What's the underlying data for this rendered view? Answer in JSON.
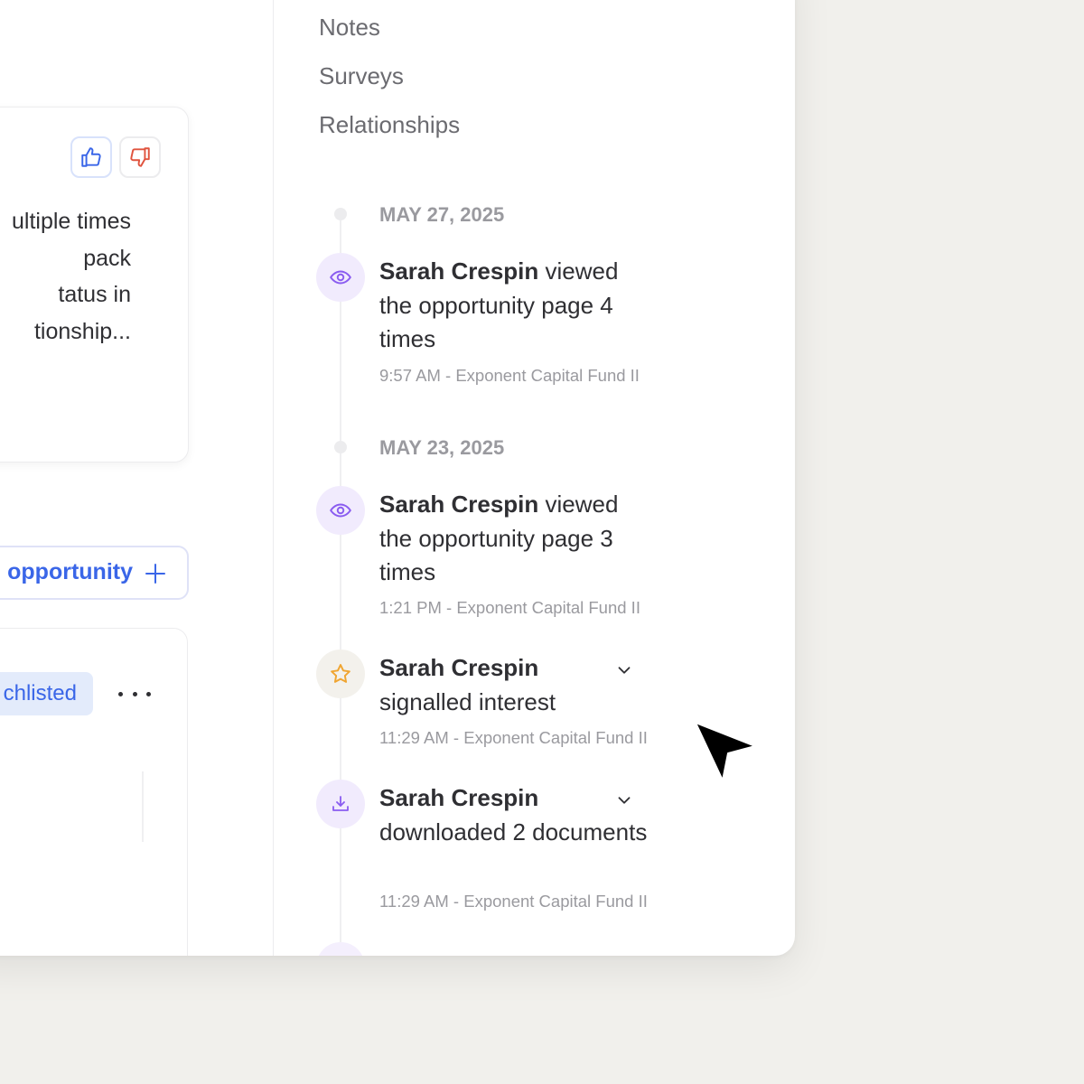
{
  "left": {
    "insight": {
      "text": "ultiple times\npack\ntatus in\ntionship..."
    },
    "add_opportunity": {
      "label": "opportunity"
    },
    "investor": {
      "status": "chlisted"
    }
  },
  "nav": {
    "notes": "Notes",
    "surveys": "Surveys",
    "relationships": "Relationships"
  },
  "timeline": {
    "groups": [
      {
        "date": "MAY 27, 2025",
        "events": [
          {
            "actor": "Sarah Crespin",
            "action": " viewed the opportunity page 4 times",
            "meta": "9:57 AM - Exponent Capital Fund II",
            "icon": "eye-icon"
          }
        ]
      },
      {
        "date": "MAY 23, 2025",
        "events": [
          {
            "actor": "Sarah Crespin",
            "action": " viewed the opportunity page 3 times",
            "meta": "1:21 PM - Exponent Capital Fund II",
            "icon": "eye-icon"
          },
          {
            "actor": "Sarah Crespin",
            "action": "signalled interest",
            "meta": "11:29 AM - Exponent Capital Fund II",
            "icon": "star-icon"
          },
          {
            "actor": "Sarah Crespin",
            "action": "downloaded 2 documents",
            "meta": "11:29 AM - Exponent Capital Fund II",
            "icon": "download-icon"
          }
        ]
      }
    ]
  },
  "colors": {
    "accent_blue": "#3a66e8",
    "thumbs_down_red": "#e0533e",
    "event_purple": "#8a5cf0",
    "star_orange": "#f0a531",
    "background": "#f1f0ec"
  }
}
